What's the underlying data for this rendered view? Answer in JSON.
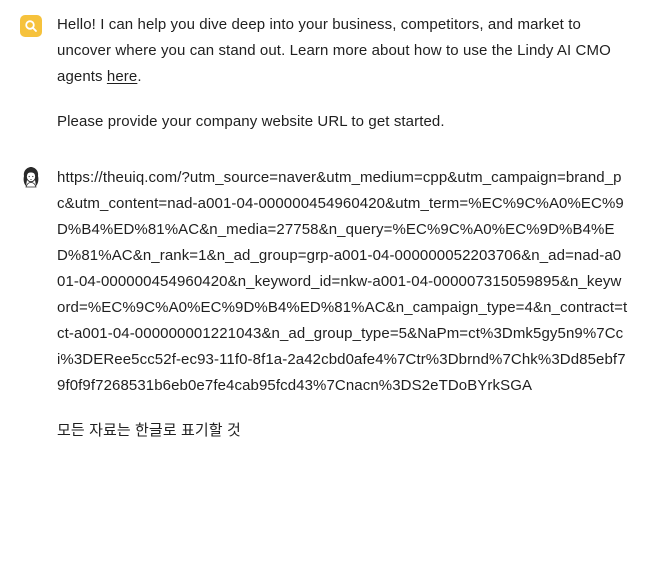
{
  "agent_message": {
    "avatar_icon": "search-icon",
    "avatar_color": "#f6c23c",
    "paragraph_1_before_link": "Hello! I can help you dive deep into your business, competitors, and market to uncover where you can stand out. Learn more about how to use the Lindy AI CMO agents ",
    "link_text": "here",
    "paragraph_1_after_link": ".",
    "paragraph_2": "Please provide your company website URL to get started."
  },
  "user_message": {
    "avatar_icon": "user-avatar-icon",
    "url": "https://theuiq.com/?utm_source=naver&utm_medium=cpp&utm_campaign=brand_pc&utm_content=nad-a001-04-000000454960420&utm_term=%EC%9C%A0%EC%9D%B4%ED%81%AC&n_media=27758&n_query=%EC%9C%A0%EC%9D%B4%ED%81%AC&n_rank=1&n_ad_group=grp-a001-04-000000052203706&n_ad=nad-a001-04-000000454960420&n_keyword_id=nkw-a001-04-000007315059895&n_keyword=%EC%9C%A0%EC%9D%B4%ED%81%AC&n_campaign_type=4&n_contract=tct-a001-04-000000001221043&n_ad_group_type=5&NaPm=ct%3Dmk5gy5n9%7Cci%3DERee5cc52f-ec93-11f0-8f1a-2a42cbd0afe4%7Ctr%3Dbrnd%7Chk%3Dd85ebf79f0f9f7268531b6eb0e7fe4cab95fcd43%7Cnacn%3DS2eTDoBYrkSGA",
    "instruction": "모든 자료는 한글로 표기할 것"
  }
}
